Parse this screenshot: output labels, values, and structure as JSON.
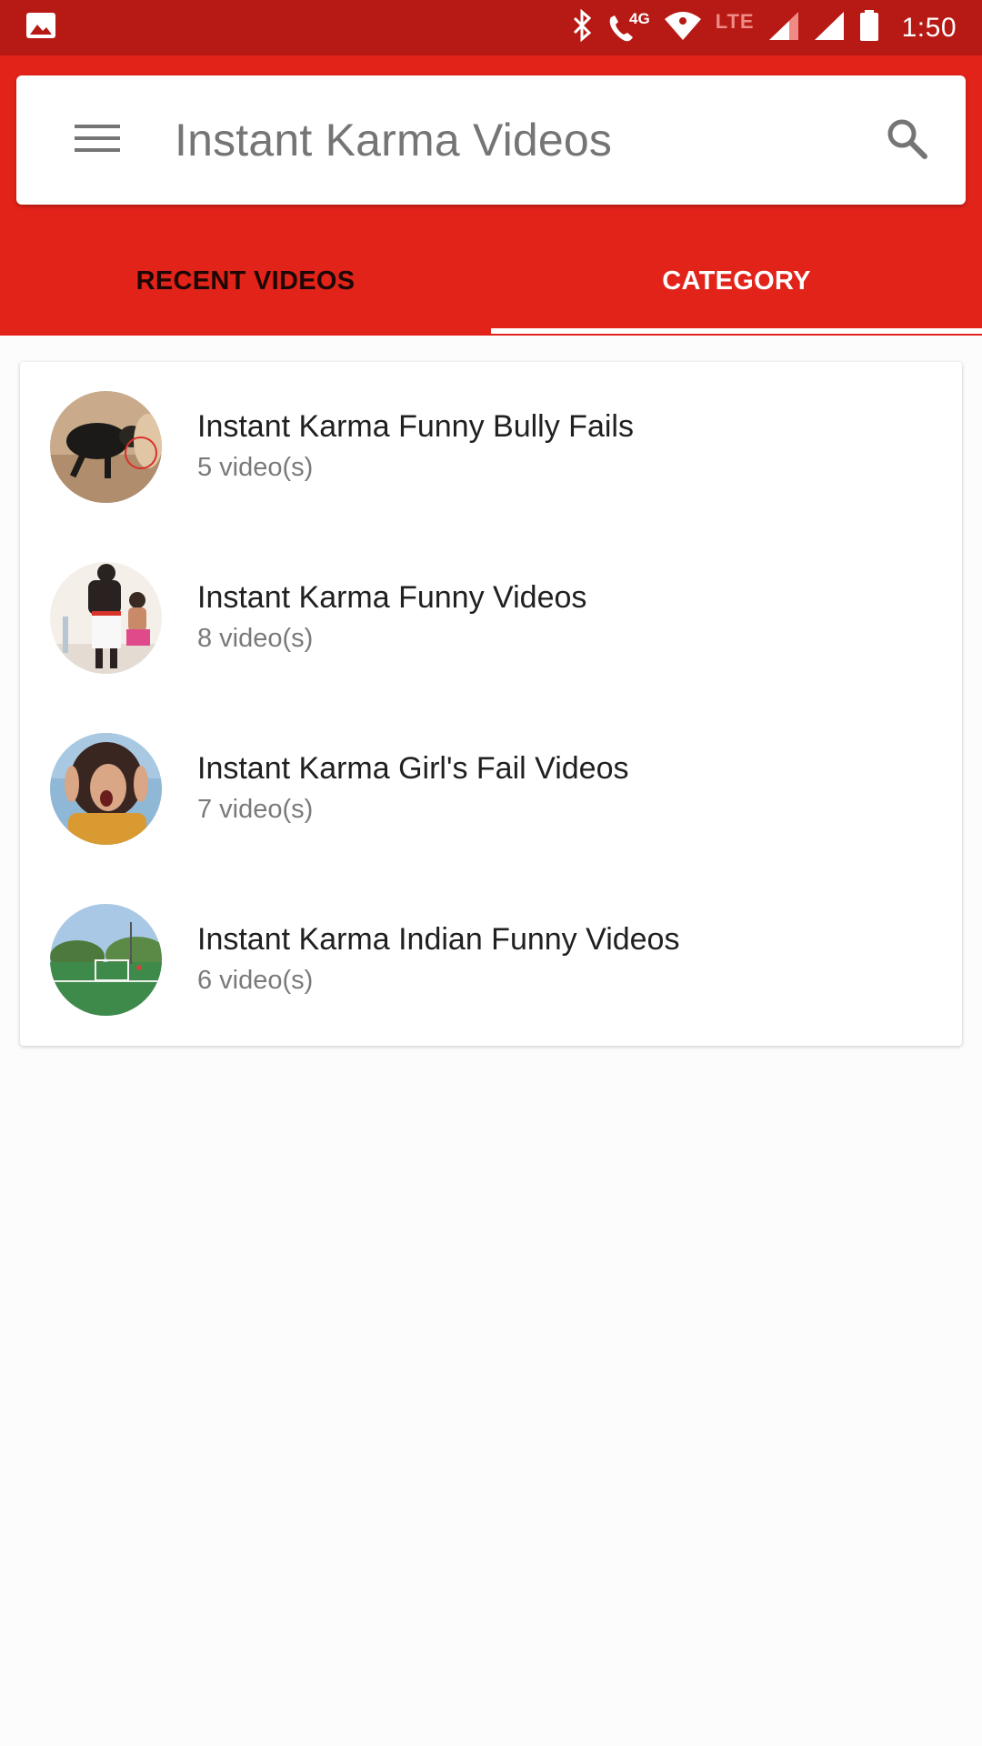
{
  "status_bar": {
    "time": "1:50",
    "network_label": "4G",
    "lte_label": "LTE",
    "icons": [
      "image-icon",
      "bluetooth-icon",
      "wifi-calling-icon",
      "wifi-icon",
      "signal-icon",
      "signal-icon",
      "battery-icon"
    ]
  },
  "header": {
    "title": "Instant Karma Videos",
    "menu_icon": "hamburger-menu-icon",
    "search_icon": "search-icon"
  },
  "tabs": [
    {
      "label": "RECENT VIDEOS",
      "selected": false
    },
    {
      "label": "CATEGORY",
      "selected": true
    }
  ],
  "categories": [
    {
      "title": "Instant Karma Funny Bully Fails",
      "count": "5 video(s)",
      "thumbnail": "bull-photo"
    },
    {
      "title": "Instant Karma Funny Videos",
      "count": "8 video(s)",
      "thumbnail": "dancers-photo"
    },
    {
      "title": "Instant Karma Girl's Fail Videos",
      "count": "7 video(s)",
      "thumbnail": "screaming-girl-photo"
    },
    {
      "title": "Instant Karma Indian Funny Videos",
      "count": "6 video(s)",
      "thumbnail": "soccer-field-photo"
    }
  ],
  "colors": {
    "status_bar": "#b71914",
    "app_bar": "#e2231a",
    "tab_selected_text": "#ffffff",
    "tab_unselected_text": "#1d0705"
  }
}
